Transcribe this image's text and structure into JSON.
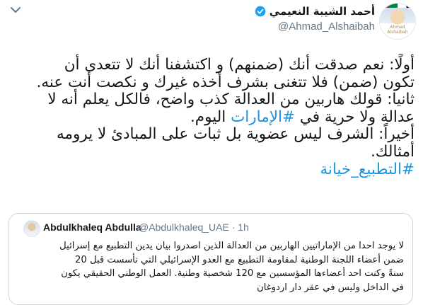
{
  "author": {
    "display_name": "أحمد الشيبة النعيمي",
    "handle": "@Ahmad_Alshaibah",
    "avatar_caption": "Ahmad Alshaibah"
  },
  "tweet": {
    "lines": [
      "أولًا: نعم صدقت أنك (ضمنهم) و اكتشفنا أنك لا تتعدى أن",
      "تكون (ضمن) فلا تتغنى بشرف أخذه غيرك و نكصت أنت عنه.",
      "ثانيا: قولك هاربين من العدالة كذب واضح، فالكل يعلم أنه لا"
    ],
    "line4_before": "عدالة ولا حرية في ",
    "line4_hashtag": "#الإمارات",
    "line4_after": " اليوم.",
    "lines_after": [
      "أخيراً: الشرف ليس عضوية بل ثبات على المبادئ لا يرومه",
      "أمثالك."
    ],
    "hashtag": "#التطبيع_خيانة"
  },
  "quote": {
    "name": "Abdulkhaleq Abdulla",
    "handle_time": "@Abdulkhaleq_UAE · 1h",
    "lines": [
      "لا يوجد احدا من الإماراتيين الهاربين من العدالة الذين اصدروا بيان يدين التطبيع مع إسرائيل",
      "ضمن أعضاء اللجنة الوطنية لمقاومة التطبيع مع العدو الإسرائيلي التي تأسست قبل 20",
      "سنةً وكنت احد أعضاءها المؤسسين مع 120 شخصية وطنية. العمل الوطني الحقيقي يكون",
      "في الداخل وليس في عقر دار اردوغان"
    ]
  },
  "icons": {
    "more": "chevron-down-icon",
    "verified": "verified-badge-icon"
  },
  "colors": {
    "link": "#1b95e0",
    "verified": "#1da1f2",
    "secondary_text": "#657786",
    "border": "#ccd6dd"
  }
}
